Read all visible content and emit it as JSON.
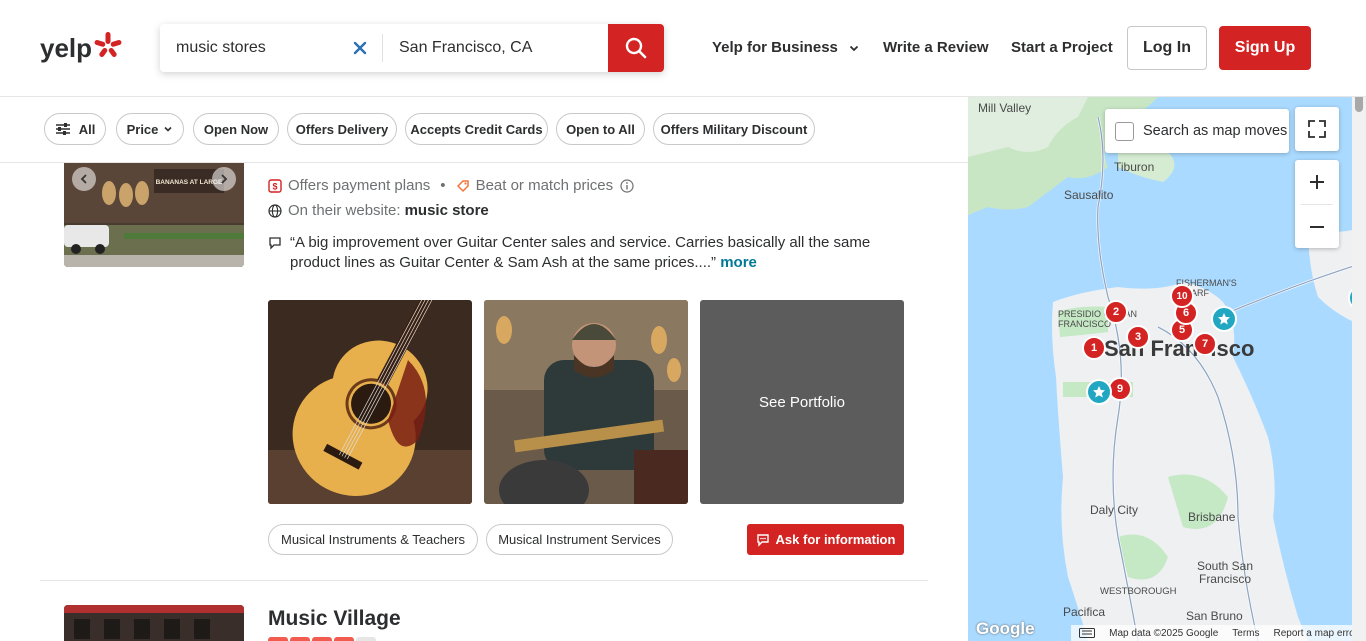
{
  "header": {
    "logo_text": "yelp",
    "search_what": "music stores",
    "search_where": "San Francisco, CA",
    "nav": {
      "business": "Yelp for Business",
      "write_review": "Write a Review",
      "start_project": "Start a Project",
      "login": "Log In",
      "signup": "Sign Up"
    }
  },
  "filters": [
    "All",
    "Price",
    "Open Now",
    "Offers Delivery",
    "Accepts Credit Cards",
    "Open to All",
    "Offers Military Discount"
  ],
  "listing": {
    "thumb_sign": "BANANAS AT LARGE",
    "payment_plans": "Offers payment plans",
    "bullet": "•",
    "beat_prices": "Beat or match prices",
    "website_prefix": "On their website:",
    "website_link": "music store",
    "quote": "“A big improvement over Guitar Center sales and service. Carries basically all the same product lines as Guitar Center & Sam Ash at the same prices....”",
    "more": "more",
    "see_portfolio": "See Portfolio",
    "tags": [
      "Musical Instruments & Teachers",
      "Musical Instrument Services"
    ],
    "ask_button": "Ask for information"
  },
  "next_listing": {
    "name": "Music Village"
  },
  "map": {
    "search_as_moves": "Search as map moves",
    "labels": {
      "mill_valley": "Mill Valley",
      "tiburon": "Tiburon",
      "sausalito": "Sausalito",
      "presidio": "PRESIDIO OF SAN FRANCISCO",
      "fishermans": "FISHERMAN'S WHARF",
      "san_francisco": "San Francisco",
      "daly_city": "Daly City",
      "brisbane": "Brisbane",
      "south_sf": "South San Francisco",
      "westborough": "WESTBOROUGH",
      "pacifica": "Pacifica",
      "san_bruno": "San Bruno"
    },
    "pins": [
      "1",
      "2",
      "3",
      "5",
      "6",
      "7",
      "9",
      "10"
    ],
    "footer": {
      "google": "Google",
      "map_data": "Map data ©2025 Google",
      "terms": "Terms",
      "report": "Report a map error"
    }
  },
  "colors": {
    "brand_red": "#d32323",
    "link_teal": "#027a97",
    "map_water": "#aadaff",
    "map_land": "#e8eef0",
    "map_green": "#c5e8c5",
    "star_pin": "#22a7c2"
  }
}
